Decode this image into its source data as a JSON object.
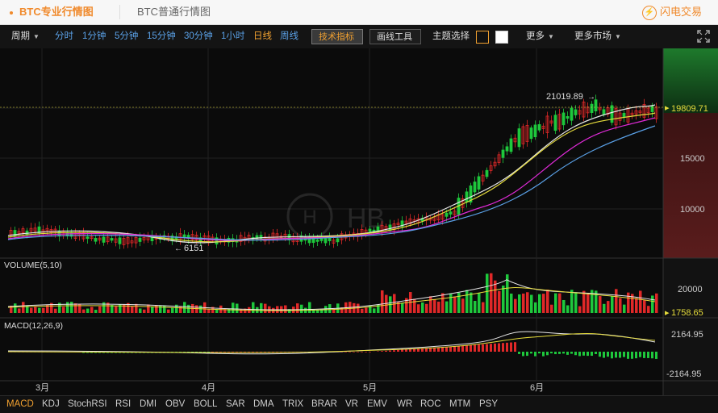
{
  "tabs": {
    "pro_label": "BTC专业行情图",
    "normal_label": "BTC普通行情图"
  },
  "brand": {
    "label": "闪电交易",
    "icon": "lightning-icon"
  },
  "toolbar": {
    "period_label": "周期",
    "intervals": [
      "分时",
      "1分钟",
      "5分钟",
      "15分钟",
      "30分钟",
      "1小时",
      "日线",
      "周线"
    ],
    "tech_label": "技术指标",
    "draw_label": "画线工具",
    "theme_label": "主题选择",
    "more_label": "更多",
    "more_market_label": "更多市场"
  },
  "chart": {
    "annotations": {
      "high": "21019.89",
      "low": "6151"
    },
    "last_price": "19809.71",
    "price_ticks": [
      "15000",
      "10000"
    ],
    "volume_title": "VOLUME(5,10)",
    "volume_tick": "20000",
    "volume_last": "1758.65",
    "macd_title": "MACD(12,26,9)",
    "macd_ticks": [
      "2164.95",
      "-2164.95"
    ],
    "months": [
      "3月",
      "4月",
      "5月",
      "6月"
    ],
    "up_color": "#e02828",
    "down_color": "#1ec83c"
  },
  "indicators": [
    "MACD",
    "KDJ",
    "StochRSI",
    "RSI",
    "DMI",
    "OBV",
    "BOLL",
    "SAR",
    "DMA",
    "TRIX",
    "BRAR",
    "VR",
    "EMV",
    "WR",
    "ROC",
    "MTM",
    "PSY"
  ]
}
